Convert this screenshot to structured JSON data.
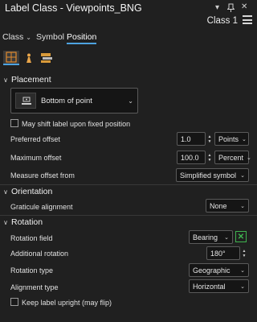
{
  "window": {
    "title": "Label Class - Viewpoints_BNG",
    "class_name": "Class 1"
  },
  "tabs": [
    {
      "label": "Class"
    },
    {
      "label": "Symbol"
    },
    {
      "label": "Position"
    }
  ],
  "sections": {
    "placement": {
      "heading": "Placement",
      "placement_value": "Bottom of point",
      "may_shift_label": "May shift label upon fixed position",
      "preferred_offset": {
        "label": "Preferred offset",
        "value": "1.0",
        "unit": "Points"
      },
      "maximum_offset": {
        "label": "Maximum offset",
        "value": "100.0",
        "unit": "Percent"
      },
      "measure_offset_from": {
        "label": "Measure offset from",
        "value": "Simplified symbol"
      }
    },
    "orientation": {
      "heading": "Orientation",
      "graticule_alignment": {
        "label": "Graticule alignment",
        "value": "None"
      }
    },
    "rotation": {
      "heading": "Rotation",
      "rotation_field": {
        "label": "Rotation field",
        "value": "Bearing"
      },
      "additional_rotation": {
        "label": "Additional rotation",
        "value": "180°"
      },
      "rotation_type": {
        "label": "Rotation type",
        "value": "Geographic"
      },
      "alignment_type": {
        "label": "Alignment type",
        "value": "Horizontal"
      },
      "keep_upright": "Keep label upright (may flip)"
    }
  },
  "colors": {
    "background": "#202020",
    "accent": "#4da3e0",
    "expression_green": "#3fb34f"
  }
}
